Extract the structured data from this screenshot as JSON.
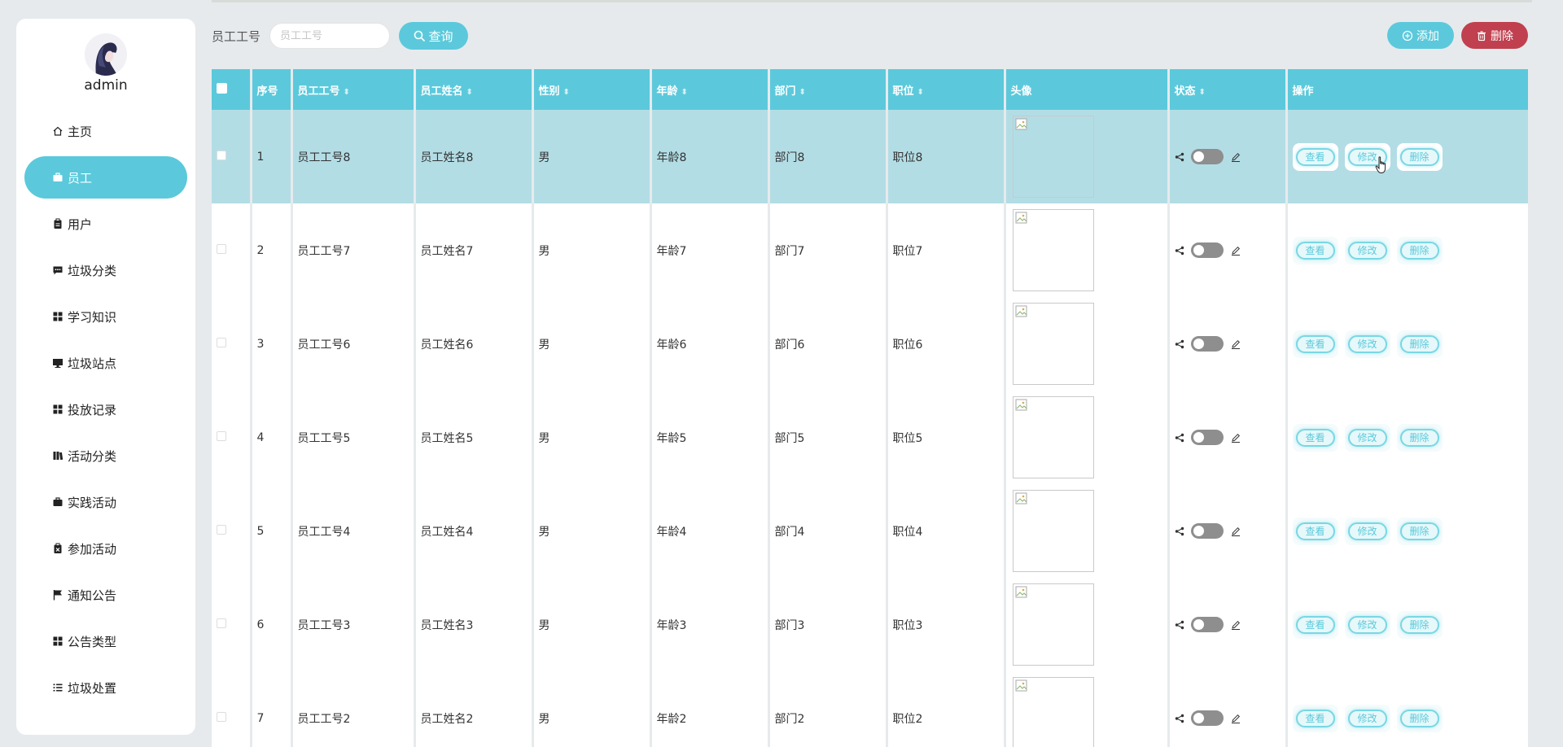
{
  "user": {
    "name": "admin"
  },
  "nav": [
    {
      "label": "主页",
      "icon": "home-icon"
    },
    {
      "label": "员工",
      "icon": "briefcase-icon",
      "active": true
    },
    {
      "label": "用户",
      "icon": "clipboard-icon"
    },
    {
      "label": "垃圾分类",
      "icon": "comment-icon"
    },
    {
      "label": "学习知识",
      "icon": "grid-icon"
    },
    {
      "label": "垃圾站点",
      "icon": "monitor-icon"
    },
    {
      "label": "投放记录",
      "icon": "grid-icon"
    },
    {
      "label": "活动分类",
      "icon": "book-icon"
    },
    {
      "label": "实践活动",
      "icon": "briefcase-icon"
    },
    {
      "label": "参加活动",
      "icon": "clipboard-x-icon"
    },
    {
      "label": "通知公告",
      "icon": "flag-icon"
    },
    {
      "label": "公告类型",
      "icon": "grid-icon"
    },
    {
      "label": "垃圾处置",
      "icon": "list-icon"
    }
  ],
  "toolbar": {
    "search_label": "员工工号",
    "search_placeholder": "员工工号",
    "search_button": "查询",
    "add_button": "添加",
    "delete_button": "删除"
  },
  "table": {
    "columns": [
      "序号",
      "员工工号",
      "员工姓名",
      "性别",
      "年龄",
      "部门",
      "职位",
      "头像",
      "状态",
      "操作"
    ],
    "actions": [
      "查看",
      "修改",
      "删除"
    ],
    "rows": [
      {
        "index": "1",
        "emp_no": "员工工号8",
        "name": "员工姓名8",
        "gender": "男",
        "age": "年龄8",
        "dept": "部门8",
        "position": "职位8"
      },
      {
        "index": "2",
        "emp_no": "员工工号7",
        "name": "员工姓名7",
        "gender": "男",
        "age": "年龄7",
        "dept": "部门7",
        "position": "职位7"
      },
      {
        "index": "3",
        "emp_no": "员工工号6",
        "name": "员工姓名6",
        "gender": "男",
        "age": "年龄6",
        "dept": "部门6",
        "position": "职位6"
      },
      {
        "index": "4",
        "emp_no": "员工工号5",
        "name": "员工姓名5",
        "gender": "男",
        "age": "年龄5",
        "dept": "部门5",
        "position": "职位5"
      },
      {
        "index": "5",
        "emp_no": "员工工号4",
        "name": "员工姓名4",
        "gender": "男",
        "age": "年龄4",
        "dept": "部门4",
        "position": "职位4"
      },
      {
        "index": "6",
        "emp_no": "员工工号3",
        "name": "员工姓名3",
        "gender": "男",
        "age": "年龄3",
        "dept": "部门3",
        "position": "职位3"
      },
      {
        "index": "7",
        "emp_no": "员工工号2",
        "name": "员工姓名2",
        "gender": "男",
        "age": "年龄2",
        "dept": "部门2",
        "position": "职位2"
      }
    ]
  },
  "colors": {
    "accent": "#5bc9db",
    "danger": "#c0404f",
    "toggle_off": "#8e8e8e"
  }
}
